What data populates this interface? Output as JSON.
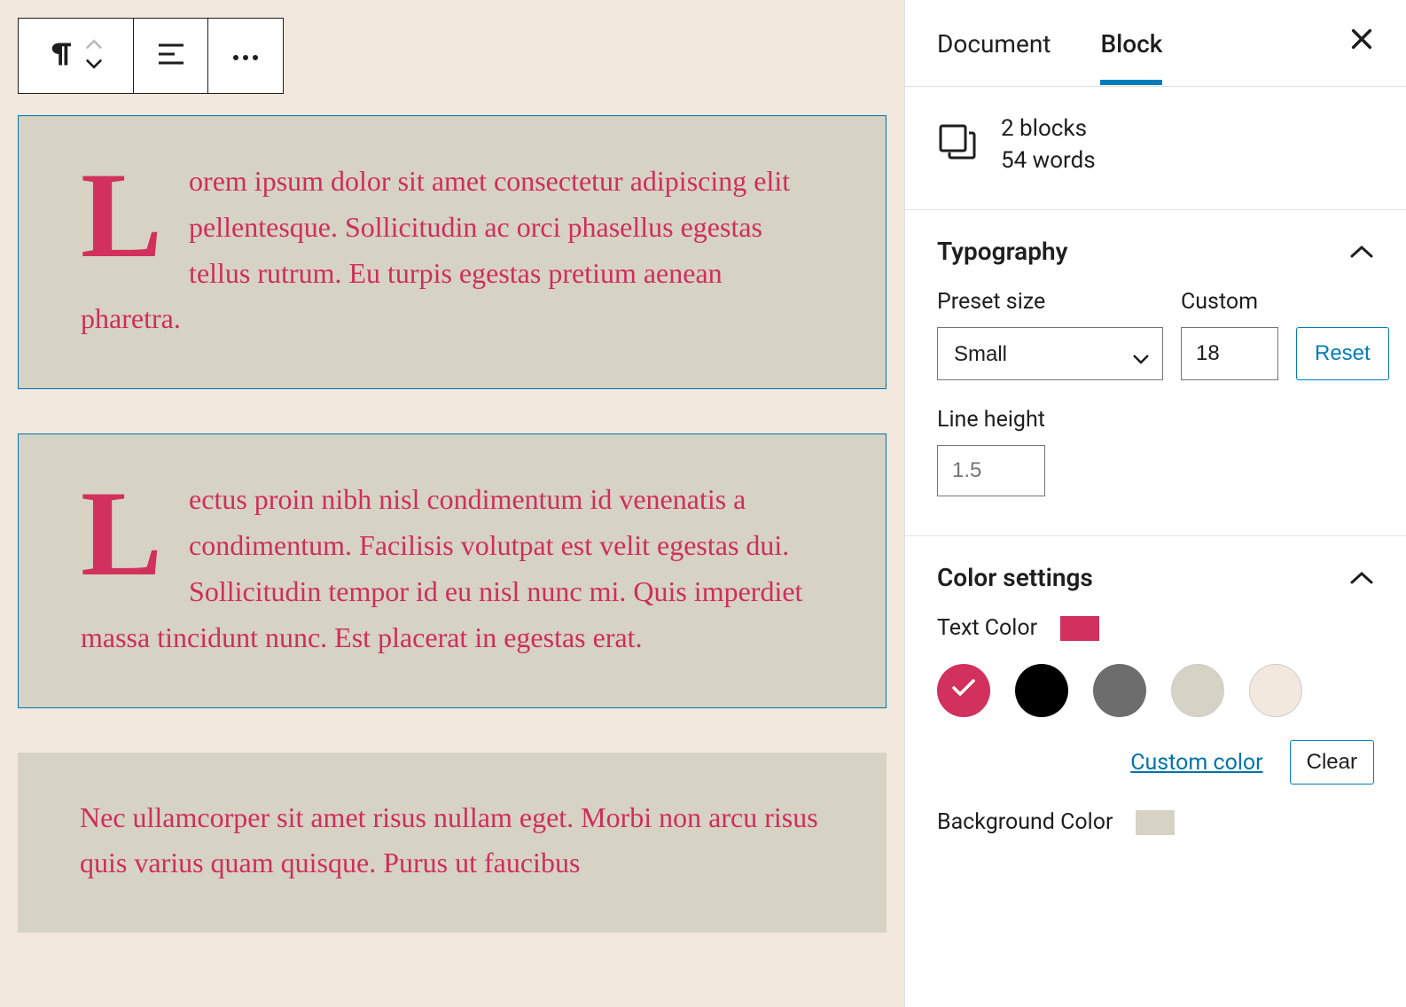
{
  "toolbar": {
    "paragraph_icon": "paragraph",
    "align_icon": "align-left",
    "more_icon": "more"
  },
  "blocks": [
    {
      "text": "Lorem ipsum dolor sit amet consectetur adipiscing elit pellentesque. Sollicitudin ac orci phasellus egestas tellus rutrum. Eu turpis egestas pretium aenean pharetra.",
      "dropcap": true,
      "selected": true
    },
    {
      "text": "Lectus proin nibh nisl condimentum id venenatis a condimentum. Facilisis volutpat est velit egestas dui. Sollicitudin tempor id eu nisl nunc mi. Quis imperdiet massa tincidunt nunc. Est placerat in egestas erat.",
      "dropcap": true,
      "selected": true
    },
    {
      "text": "Nec ullamcorper sit amet risus nullam eget. Morbi non arcu risus quis varius quam quisque. Purus ut faucibus",
      "dropcap": false,
      "selected": false
    }
  ],
  "sidebar": {
    "tabs": {
      "document": "Document",
      "block": "Block",
      "active": "block"
    },
    "summary": {
      "line1": "2 blocks",
      "line2": "54 words"
    },
    "typography": {
      "title": "Typography",
      "preset_label": "Preset size",
      "preset_value": "Small",
      "custom_label": "Custom",
      "custom_value": "18",
      "reset_label": "Reset",
      "line_height_label": "Line height",
      "line_height_value": "1.5"
    },
    "color": {
      "title": "Color settings",
      "text_label": "Text Color",
      "text_swatch": "#d1315c",
      "swatches": [
        "#d1315c",
        "#000000",
        "#6d6d6d",
        "#d6d2c4",
        "#f2e8de"
      ],
      "selected_index": 0,
      "custom_link": "Custom color",
      "clear_label": "Clear",
      "bg_label": "Background Color",
      "bg_swatch": "#d6d2c4"
    }
  }
}
